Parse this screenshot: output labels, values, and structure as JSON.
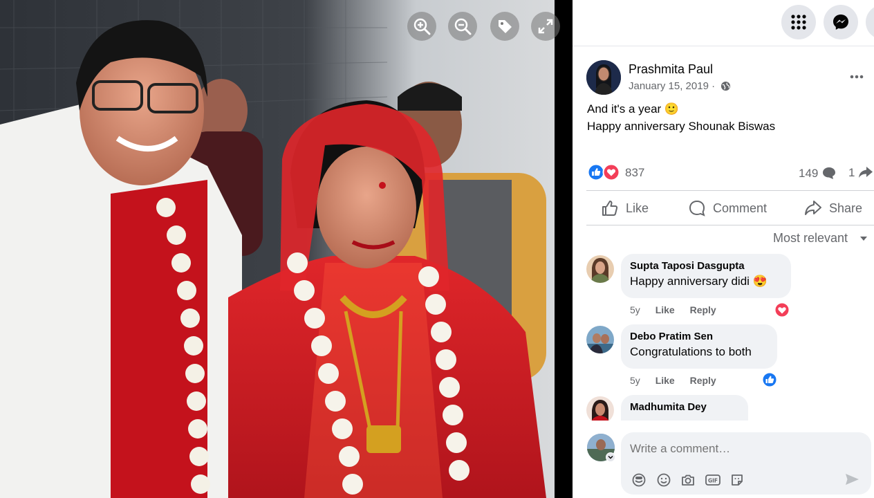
{
  "viewer": {
    "tools": [
      {
        "icon": "zoom-in-icon"
      },
      {
        "icon": "zoom-out-icon"
      },
      {
        "icon": "tag-icon"
      },
      {
        "icon": "fullscreen-icon"
      }
    ]
  },
  "topbar": {
    "icons": [
      "menu-grid-icon",
      "messenger-icon",
      "notifications-icon"
    ]
  },
  "post": {
    "author": "Prashmita Paul",
    "date": "January 15, 2019 ·",
    "privacy_icon": "globe-icon",
    "text_line1": "And it's a year 🙂",
    "text_line2": "Happy anniversary Shounak Biswas",
    "reaction_icons": [
      "like-reaction-icon",
      "love-reaction-icon"
    ],
    "reaction_count": "837",
    "comment_count": "149",
    "share_count": "1"
  },
  "actions": {
    "like": "Like",
    "comment": "Comment",
    "share": "Share"
  },
  "sort": {
    "label": "Most relevant"
  },
  "comments": [
    {
      "name": "Supta Taposi Dasgupta",
      "text": "Happy anniversary didi 😍",
      "time": "5y",
      "like": "Like",
      "reply": "Reply",
      "reaction": "love-reaction-icon"
    },
    {
      "name": "Debo Pratim Sen",
      "text": "Congratulations to both",
      "time": "5y",
      "like": "Like",
      "reply": "Reply",
      "reaction": "like-reaction-icon"
    },
    {
      "name": "Madhumita Dey",
      "text": ""
    }
  ],
  "composer": {
    "placeholder": "Write a comment…",
    "icons": [
      "avatar-sticker-icon",
      "emoji-icon",
      "camera-icon",
      "gif-icon",
      "sticker-icon"
    ],
    "send_icon": "send-icon"
  },
  "colors": {
    "facebook_blue": "#1877f2",
    "love_red": "#f33e58",
    "secondary_text": "#65676b"
  }
}
